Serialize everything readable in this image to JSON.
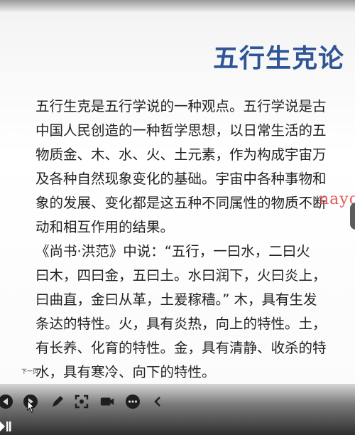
{
  "slide": {
    "title": "五行生克论",
    "paragraph1": [
      "五行生克是五行学说的一种观点。五行学说是古",
      "中国人民创造的一种哲学思想，以日常生活的五",
      "物质金、木、水、火、土元素，作为构成宇宙万",
      "及各种自然现象变化的基础。宇宙中各种事物和",
      "象的发展、变化都是这五种不同属性的物质不断",
      "动和相互作用的结果。"
    ],
    "paragraph2": [
      "《尚书·洪范》中说：“五行，一曰水，二曰火",
      "曰木，四曰金，五曰土。水曰润下，火曰炎上，",
      "曰曲直，金曰从革，土爰稼穑。” 木，具有生发",
      "条达的特性。火，具有炎热，向上的特性。土，",
      "有长养、化育的特性。金，具有清静、收杀的特",
      "水，具有寒冷、向下的特性。"
    ],
    "watermark": "nayo"
  },
  "player": {
    "next_page_label": "下一页",
    "buttons": [
      {
        "id": "prev",
        "icon": "play-back-icon"
      },
      {
        "id": "next",
        "icon": "play-forward-icon"
      },
      {
        "id": "pen",
        "icon": "pen-icon"
      },
      {
        "id": "screen",
        "icon": "fullscreen-icon"
      },
      {
        "id": "camera",
        "icon": "camera-icon"
      },
      {
        "id": "more",
        "icon": "more-icon"
      },
      {
        "id": "collapse",
        "icon": "chevron-left-icon"
      }
    ]
  }
}
